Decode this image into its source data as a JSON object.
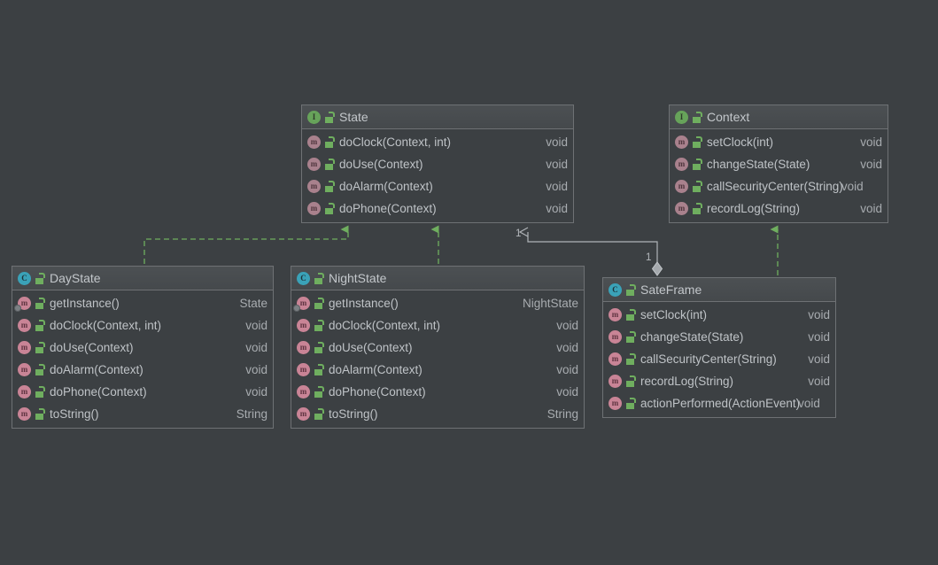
{
  "diagram": {
    "title": "UML Class Diagram",
    "background_color": "#3c4043",
    "colors": {
      "interface_icon": "#67a35a",
      "class_icon": "#3aa2b8",
      "method_icon": "#c98496",
      "realization_line": "#6fae5f",
      "aggregation_line": "#b0b4b8",
      "box_border": "#6e7174",
      "text": "#bfc3c7"
    }
  },
  "boxes": {
    "state": {
      "name": "State",
      "stereotype": "interface",
      "icon": "interface-icon",
      "visibility_icon": "public-unlock-icon",
      "members": [
        {
          "name": "doClock(Context, int)",
          "type": "void",
          "icon": "method-icon",
          "static": false
        },
        {
          "name": "doUse(Context)",
          "type": "void",
          "icon": "method-icon",
          "static": false
        },
        {
          "name": "doAlarm(Context)",
          "type": "void",
          "icon": "method-icon",
          "static": false
        },
        {
          "name": "doPhone(Context)",
          "type": "void",
          "icon": "method-icon",
          "static": false
        }
      ]
    },
    "context": {
      "name": "Context",
      "stereotype": "interface",
      "icon": "interface-icon",
      "visibility_icon": "public-unlock-icon",
      "members": [
        {
          "name": "setClock(int)",
          "type": "void",
          "icon": "method-icon",
          "static": false,
          "clipped": false
        },
        {
          "name": "changeState(State)",
          "type": "void",
          "icon": "method-icon",
          "static": false,
          "clipped": false
        },
        {
          "name": "callSecurityCenter(String)",
          "type": "void",
          "icon": "method-icon",
          "static": false,
          "clipped": true
        },
        {
          "name": "recordLog(String)",
          "type": "void",
          "icon": "method-icon",
          "static": false,
          "clipped": false
        }
      ]
    },
    "daystate": {
      "name": "DayState",
      "stereotype": "class",
      "icon": "class-icon",
      "visibility_icon": "public-unlock-icon",
      "members": [
        {
          "name": "getInstance()",
          "type": "State",
          "icon": "method-icon",
          "static": true
        },
        {
          "name": "doClock(Context, int)",
          "type": "void",
          "icon": "method-icon",
          "static": false
        },
        {
          "name": "doUse(Context)",
          "type": "void",
          "icon": "method-icon",
          "static": false
        },
        {
          "name": "doAlarm(Context)",
          "type": "void",
          "icon": "method-icon",
          "static": false
        },
        {
          "name": "doPhone(Context)",
          "type": "void",
          "icon": "method-icon",
          "static": false
        },
        {
          "name": "toString()",
          "type": "String",
          "icon": "method-icon",
          "static": false
        }
      ]
    },
    "nightstate": {
      "name": "NightState",
      "stereotype": "class",
      "icon": "class-icon",
      "visibility_icon": "public-unlock-icon",
      "members": [
        {
          "name": "getInstance()",
          "type": "NightState",
          "icon": "method-icon",
          "static": true
        },
        {
          "name": "doClock(Context, int)",
          "type": "void",
          "icon": "method-icon",
          "static": false
        },
        {
          "name": "doUse(Context)",
          "type": "void",
          "icon": "method-icon",
          "static": false
        },
        {
          "name": "doAlarm(Context)",
          "type": "void",
          "icon": "method-icon",
          "static": false
        },
        {
          "name": "doPhone(Context)",
          "type": "void",
          "icon": "method-icon",
          "static": false
        },
        {
          "name": "toString()",
          "type": "String",
          "icon": "method-icon",
          "static": false
        }
      ]
    },
    "sateframe": {
      "name": "SateFrame",
      "stereotype": "class",
      "icon": "class-icon",
      "visibility_icon": "public-unlock-icon",
      "members": [
        {
          "name": "setClock(int)",
          "type": "void",
          "icon": "method-icon",
          "static": false,
          "clipped": false
        },
        {
          "name": "changeState(State)",
          "type": "void",
          "icon": "method-icon",
          "static": false,
          "clipped": false
        },
        {
          "name": "callSecurityCenter(String)",
          "type": "void",
          "icon": "method-icon",
          "static": false,
          "clipped": false
        },
        {
          "name": "recordLog(String)",
          "type": "void",
          "icon": "method-icon",
          "static": false,
          "clipped": false
        },
        {
          "name": "actionPerformed(ActionEvent)",
          "type": "void",
          "icon": "method-icon",
          "static": false,
          "clipped": true
        }
      ]
    }
  },
  "relationships": {
    "daystate_implements_state": {
      "type": "realization",
      "from": "DayState",
      "to": "State",
      "style": "dashed",
      "arrow": "closed-triangle"
    },
    "nightstate_implements_state": {
      "type": "realization",
      "from": "NightState",
      "to": "State",
      "style": "dashed",
      "arrow": "closed-triangle"
    },
    "sateframe_implements_context": {
      "type": "realization",
      "from": "SateFrame",
      "to": "Context",
      "style": "dashed",
      "arrow": "closed-triangle"
    },
    "sateframe_aggregates_state": {
      "type": "aggregation",
      "from": "SateFrame",
      "to": "State",
      "style": "solid",
      "arrow": "open-arrow",
      "source_multiplicity": "1",
      "target_multiplicity": "1"
    }
  }
}
